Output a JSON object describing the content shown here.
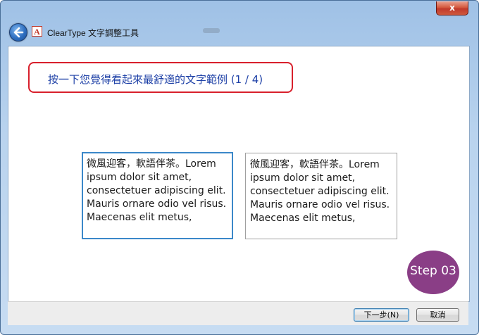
{
  "window": {
    "close_label": "x",
    "app_title": "ClearType 文字調整工具",
    "app_icon_letter": "A"
  },
  "instruction": {
    "text": "按一下您覺得看起來最舒適的文字範例  (1 / 4)"
  },
  "samples": [
    {
      "lines": [
        "微風迎客，軟語伴茶。Lorem",
        "ipsum dolor sit amet,",
        "consectetuer adipiscing elit.",
        "Mauris ornare odio vel risus.",
        "Maecenas elit metus,"
      ],
      "selected": true
    },
    {
      "lines": [
        "微風迎客，軟語伴茶。Lorem",
        "ipsum dolor sit amet,",
        "consectetuer adipiscing elit.",
        "Mauris ornare odio vel risus.",
        "Maecenas elit metus,"
      ],
      "selected": false
    }
  ],
  "badge": {
    "text": "Step 03",
    "color": "#8a3e86"
  },
  "buttons": {
    "next_label": "下一步(N)",
    "cancel_label": "取消"
  },
  "colors": {
    "highlight_border": "#d8202c",
    "instruction_text": "#1c3fa6",
    "selected_sample_border": "#3b88c9"
  }
}
